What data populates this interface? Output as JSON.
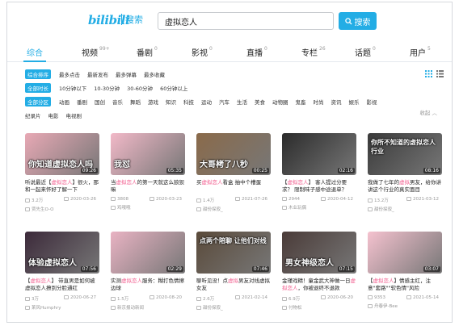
{
  "header": {
    "logo": "bilibili",
    "logo_sub": "搜索",
    "search_value": "虚拟恋人",
    "search_button": "搜索"
  },
  "tabs": [
    {
      "label": "综合",
      "count": ""
    },
    {
      "label": "视频",
      "count": "99+"
    },
    {
      "label": "番剧",
      "count": "0"
    },
    {
      "label": "影视",
      "count": "0"
    },
    {
      "label": "直播",
      "count": "0"
    },
    {
      "label": "专栏",
      "count": "26"
    },
    {
      "label": "话题",
      "count": "0"
    },
    {
      "label": "用户",
      "count": "5"
    }
  ],
  "filters": {
    "order": [
      "综合排序",
      "最多点击",
      "最新发布",
      "最多弹幕",
      "最多收藏"
    ],
    "duration": [
      "全部时长",
      "10分钟以下",
      "10-30分钟",
      "30-60分钟",
      "60分钟以上"
    ],
    "zones_row1": [
      "全部分区",
      "动画",
      "番剧",
      "国创",
      "音乐",
      "舞蹈",
      "游戏",
      "知识",
      "科技",
      "运动",
      "汽车",
      "生活",
      "美食",
      "动物圈",
      "鬼畜",
      "时尚",
      "资讯",
      "娱乐",
      "影视"
    ],
    "zones_row2": [
      "纪录片",
      "电影",
      "电视剧"
    ],
    "fold": "收起"
  },
  "cards": [
    {
      "title_pre": "听说最近【",
      "title_hl": "虚拟恋人",
      "title_post": "】很火，那和一起来怀好了解一下",
      "duration": "09:26",
      "plays": "3.2万",
      "date": "2020-03-26",
      "uploader": "贾先生O-O",
      "caption": "你知道虚拟恋人吗",
      "bg": "#e8a9b5"
    },
    {
      "title_pre": "当",
      "title_hl": "虚拟恋人",
      "title_post": "的第一天就这么狼狈嘛",
      "duration": "05:35",
      "plays": "3808",
      "date": "2020-03-23",
      "uploader": "鸡哦哦",
      "caption": "我怼",
      "bg": "#f2b9c8"
    },
    {
      "title_pre": "买",
      "title_hl": "虚拟恋人",
      "title_post": "看盒 抽中个槽蛋",
      "duration": "00:25",
      "plays": "1.4万",
      "date": "2021-07-26",
      "uploader": "甜份探寂_",
      "caption": "大哥栲了八秒",
      "bg": "#8a6a4a"
    },
    {
      "title_pre": "【",
      "title_hl": "虚拟恋人",
      "title_post": "】 客人提过分要求？ 限制味子感中途退单？",
      "duration": "02:16",
      "plays": "2944",
      "date": "2020-04-12",
      "uploader": "木业玩偶",
      "caption": "",
      "bg": "#2b2b2b"
    },
    {
      "title_pre": "我做了七年的",
      "title_hl": "虚拟",
      "title_post": "男友，给你讲讲这个行业的真实面目",
      "duration": "08:16",
      "plays": "13.2万",
      "date": "2021-03-12",
      "uploader": "甜份探寂_",
      "caption": "你所不知道的虚拟恋人行业",
      "bg": "#3a3a3a"
    },
    {
      "title_pre": "【",
      "title_hl": "虚拟恋人",
      "title_post": "】 带直男是如何被虚拟恋人撩到分脸通红",
      "duration": "07:56",
      "plays": "3万",
      "date": "2020-06-27",
      "uploader": "莱风Humphry",
      "caption": "体验虚拟恋人",
      "bg": "#3c2a3a"
    },
    {
      "title_pre": "实测",
      "title_hl": "虚拟恋人",
      "title_post": "服务：糊打色情擦边球",
      "duration": "02:29",
      "plays": "1.5万",
      "date": "2020-08-20",
      "uploader": "新京报动新闻",
      "caption": "",
      "bg": "#e9b3c3"
    },
    {
      "title_pre": "聊听见没！点",
      "title_hl": "虚拟",
      "title_post": "男友对线虚拟女友",
      "duration": "07:46",
      "plays": "2.6万",
      "date": "2021-02-14",
      "uploader": "甜份探寂_",
      "caption": "点两个陪聊 让他们对线",
      "bg": "#5a4a3a"
    },
    {
      "title_pre": "金瑾戏精！童金武大神做一日",
      "title_hl": "虚拟恋人",
      "title_post": "，你被退终不退款",
      "duration": "07:15",
      "plays": "6.9万",
      "date": "2020-06-20",
      "uploader": "付物松",
      "caption": "男女神级恋人",
      "bg": "#4a3b38"
    },
    {
      "title_pre": "【",
      "title_hl": "虚拟恋人",
      "title_post": "】情感主红，注意\"套路\"\"软色情\"风险",
      "duration": "03:07",
      "plays": "9353",
      "date": "2021-05-14",
      "uploader": "舟春伊-Bee",
      "caption": "",
      "bg": "#f5c2cf"
    }
  ],
  "colors": {
    "accent": "#23ade5",
    "highlight": "#f25d8e",
    "muted": "#999999"
  }
}
